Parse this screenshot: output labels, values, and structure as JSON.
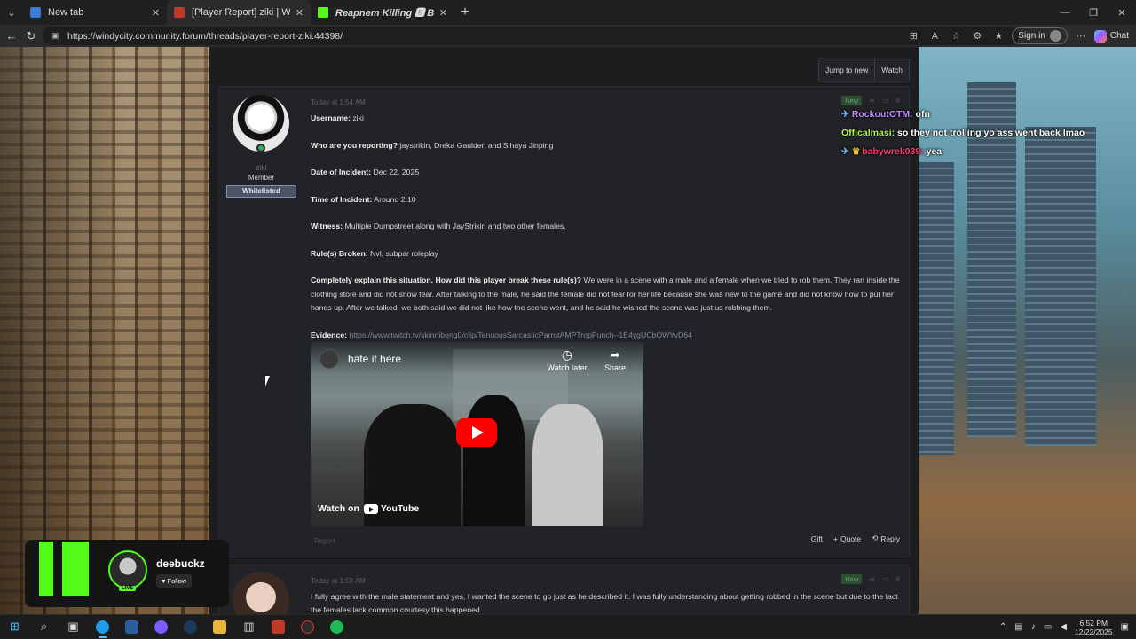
{
  "browser": {
    "tabs": [
      {
        "label": "New tab",
        "icon": "edge-newtab-icon",
        "color": "#3a7bd5"
      },
      {
        "label": "[Player Report] ziki | Windy City Ro",
        "icon": "forum-favicon-icon",
        "color": "#c0392b"
      },
      {
        "label": "Reapnem Killing 🅱 Bam🔴 (🅐🅘",
        "icon": "kick-favicon-icon",
        "color": "#53fc18"
      }
    ],
    "url": "https://windycity.community.forum/threads/player-report-ziki.44398/",
    "signin_label": "Sign in",
    "chat_label": "Chat"
  },
  "forum": {
    "jump_label": "Jump to new",
    "watch_label": "Watch",
    "post1": {
      "username": "ziki",
      "user_title": "Member",
      "banner": "Whitelisted",
      "time": "Today at 1:54 AM",
      "new_badge": "New",
      "fields": [
        {
          "label": "Username:",
          "value": " ziki"
        },
        {
          "label": "Who are you reporting?",
          "value": " jaystrikin, Dreka Gaulden and Sihaya Jinping"
        },
        {
          "label": "Date of Incident:",
          "value": " Dec 22, 2025"
        },
        {
          "label": "Time of Incident:",
          "value": " Around 2:10"
        },
        {
          "label": "Witness:",
          "value": " Multiple Dumpstreet along with JayStrikin and two other females."
        },
        {
          "label": "Rule(s) Broken:",
          "value": " Nvl, subpar roleplay"
        },
        {
          "label": "Completely explain this situation. How did this player break these rule(s)?",
          "value": " We were in a scene with a male and a female when we tried to rob them. They ran inside the clothing store and did not show fear. After talking to the male, he said the female did not fear for her life because she was new to the game and did not know how to put her hands up. After we talked, we both said we did not like how the scene went, and he said he wished the scene was just us robbing them."
        }
      ],
      "evidence_label": "Evidence:",
      "evidence_link": "https://www.twitch.tv/skinnibeng0/clip/TenuousSarcasticParrotAMPTropPunch--1E4ygUCbOWYvD64",
      "report_label": "Report",
      "actions": {
        "gift": "Gift",
        "quote": "Quote",
        "reply": "Reply"
      }
    },
    "post2": {
      "time": "Today at 1:58 AM",
      "new_badge": "New",
      "text": "I fully agree with the male statement and yes, I wanted the scene to go just as he described it. I was fully understanding about getting robbed in the scene but due to the fact the females lack common courtesy this happened"
    }
  },
  "video": {
    "title": "hate it here",
    "watch_later": "Watch later",
    "share": "Share",
    "watch_on": "Watch on",
    "youtube": "YouTube"
  },
  "stream_chat": [
    {
      "user": "RockoutOTM:",
      "msg": " ofn",
      "color": "#c18cff"
    },
    {
      "user": "Officalmasi:",
      "msg": " so they not trolling yo ass went back lmao",
      "color": "#b6f54a"
    },
    {
      "user": "babywrek039:",
      "msg": " yea",
      "color": "#ff3d6a"
    }
  ],
  "kick_widget": {
    "streamer": "deebuckz",
    "live": "LIVE",
    "follow": "Follow"
  },
  "taskbar": {
    "time": "6:52 PM",
    "date": "12/22/2025"
  }
}
